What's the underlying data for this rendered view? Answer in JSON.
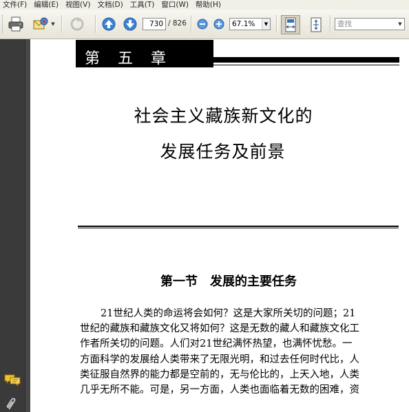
{
  "menu": [
    "文件(F)",
    "编辑(E)",
    "视图(V)",
    "文档(D)",
    "工具(T)",
    "窗口(W)",
    "帮助(H)"
  ],
  "toolbar": {
    "current_page": "730",
    "total_pages": "/ 826",
    "zoom": "67.1%",
    "find_placeholder": "查找"
  },
  "icons": {
    "print": "print-icon",
    "email": "email-icon",
    "prev_page": "arrow-up-icon",
    "next_page": "arrow-down-icon",
    "zoom_out": "zoom-out-icon",
    "zoom_in": "zoom-in-icon",
    "fit_width": "fit-width-icon",
    "fit_page": "fit-page-icon",
    "comments": "comment-icon",
    "attachments": "paperclip-icon"
  },
  "document": {
    "chapter": "第五章",
    "title_line1": "社会主义藏族新文化的",
    "title_line2": "发展任务及前景",
    "section": "第一节　发展的主要任务",
    "paragraph_lines": [
      "21世纪人类的命运将会如何？这是大家所关切的问题；21",
      "世纪的藏族和藏族文化又将如何？这是无数的藏人和藏族文化工",
      "作者所关切的问题。人们对21世纪满怀热望，也满怀忧愁。一",
      "方面科学的发展给人类带来了无限光明，和过去任何时代比，人",
      "类征服自然界的能力都是空前的，无与伦比的，上天入地，人类",
      "几乎无所不能。可是，另一方面，人类也面临着无数的困难，资"
    ]
  },
  "colors": {
    "menubar_bg": "#f1efe6",
    "toolbar_bg": "#ece9df",
    "left_panel": "#3a3a3a",
    "chapter_band": "#000000"
  }
}
